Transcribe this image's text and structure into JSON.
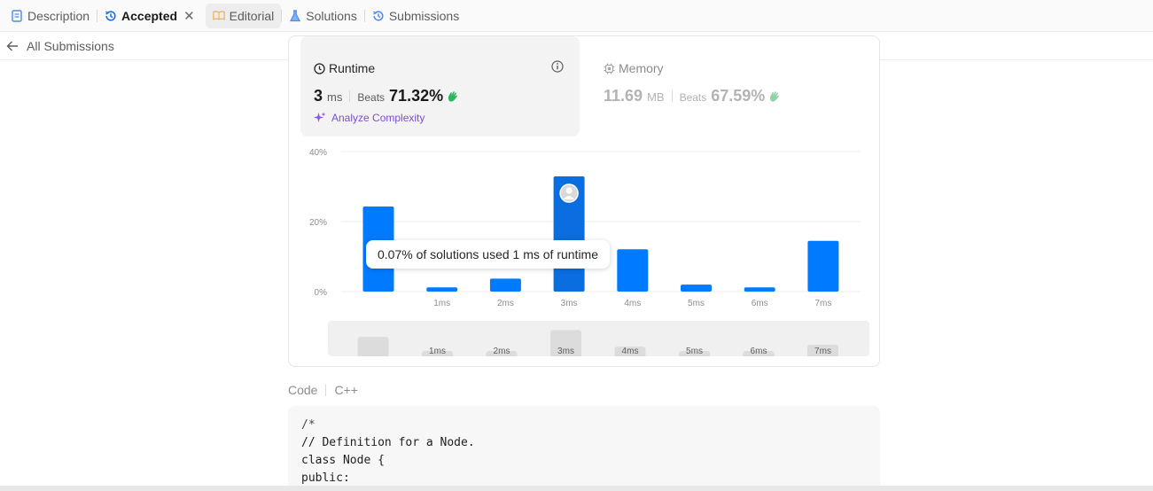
{
  "tabs": [
    {
      "label": "Description",
      "icon": "description-icon",
      "color": "#4b8be8"
    },
    {
      "label": "Accepted",
      "icon": "history-icon",
      "color": "#1e6fd9",
      "active": true
    },
    {
      "label": "Editorial",
      "icon": "book-icon",
      "color": "#f0b232"
    },
    {
      "label": "Solutions",
      "icon": "flask-icon",
      "color": "#4b8be8"
    },
    {
      "label": "Submissions",
      "icon": "history-icon",
      "color": "#4b8be8"
    }
  ],
  "back": {
    "label": "All Submissions"
  },
  "runtime": {
    "title": "Runtime",
    "value": "3",
    "unit": "ms",
    "beats_label": "Beats",
    "beats_value": "71.32%",
    "analyze_label": "Analyze Complexity"
  },
  "memory": {
    "title": "Memory",
    "value": "11.69",
    "unit": "MB",
    "beats_label": "Beats",
    "beats_value": "67.59%"
  },
  "chart_data": {
    "type": "bar",
    "categories": [
      "",
      "1ms",
      "2ms",
      "3ms",
      "4ms",
      "5ms",
      "6ms",
      "7ms"
    ],
    "values": [
      24.3,
      1.2,
      3.7,
      32.9,
      12.1,
      2.0,
      1.2,
      14.5
    ],
    "ylim": [
      0,
      40
    ],
    "yticks": [
      "0%",
      "20%",
      "40%"
    ],
    "highlight": "3ms",
    "bar_color": "#007aff",
    "highlight_color": "#0a6ee0",
    "grid": true
  },
  "tooltip": {
    "text": "0.07% of solutions used 1 ms of runtime"
  },
  "code": {
    "label": "Code",
    "language": "C++",
    "lines": [
      "/*",
      "// Definition for a Node.",
      "class Node {",
      "public:"
    ]
  }
}
